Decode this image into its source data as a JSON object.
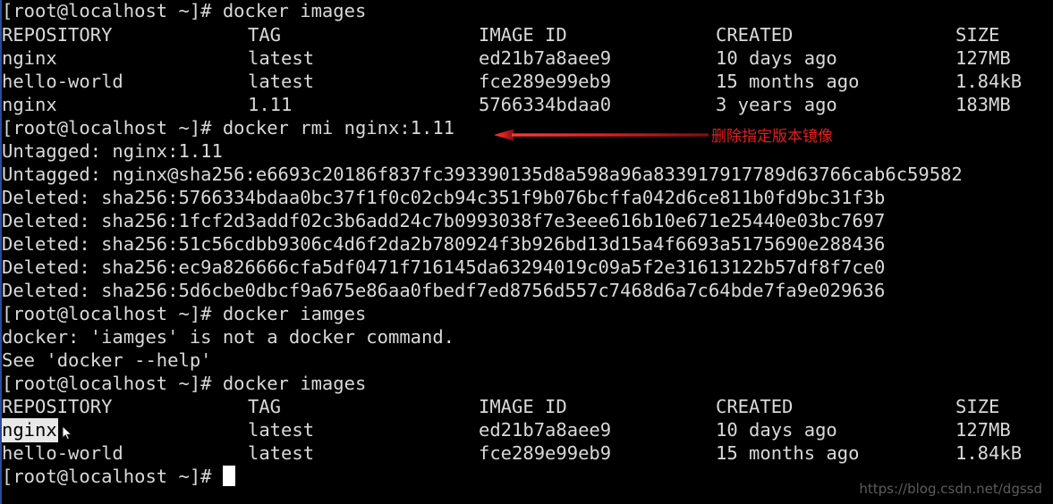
{
  "terminal": {
    "prompt": "[root@localhost ~]# ",
    "background_color": "#000000",
    "foreground_color": "#d9d9d9",
    "accent_stripe_color": "#2b4a9b",
    "selection_background": "#e8e8e8",
    "selection_foreground": "#000000"
  },
  "table_headers": {
    "repository": "REPOSITORY",
    "tag": "TAG",
    "image_id": "IMAGE ID",
    "created": "CREATED",
    "size": "SIZE"
  },
  "commands": {
    "images_1": "docker images",
    "rmi": "docker rmi nginx:1.11",
    "images_typo": "docker iamges",
    "images_2": "docker images"
  },
  "first_images_table": [
    {
      "repository": "nginx",
      "tag": "latest",
      "image_id": "ed21b7a8aee9",
      "created": "10 days ago",
      "size": "127MB"
    },
    {
      "repository": "hello-world",
      "tag": "latest",
      "image_id": "fce289e99eb9",
      "created": "15 months ago",
      "size": "1.84kB"
    },
    {
      "repository": "nginx",
      "tag": "1.11",
      "image_id": "5766334bdaa0",
      "created": "3 years ago",
      "size": "183MB"
    }
  ],
  "rmi_output": [
    "Untagged: nginx:1.11",
    "Untagged: nginx@sha256:e6693c20186f837fc393390135d8a598a96a833917917789d63766cab6c59582",
    "Deleted: sha256:5766334bdaa0bc37f1f0c02cb94c351f9b076bcffa042d6ce811b0fd9bc31f3b",
    "Deleted: sha256:1fcf2d3addf02c3b6add24c7b0993038f7e3eee616b10e671e25440e03bc7697",
    "Deleted: sha256:51c56cdbb9306c4d6f2da2b780924f3b926bd13d15a4f6693a5175690e288436",
    "Deleted: sha256:ec9a826666cfa5df0471f716145da63294019c09a5f2e31613122b57df8f7ce0",
    "Deleted: sha256:5d6cbe0dbcf9a675e86aa0fbedf7ed8756d557c7468d6a7c64bde7fa9e029636"
  ],
  "error_output": [
    "docker: 'iamges' is not a docker command.",
    "See 'docker --help'"
  ],
  "second_images_table": [
    {
      "repository": "nginx",
      "tag": "latest",
      "image_id": "ed21b7a8aee9",
      "created": "10 days ago",
      "size": "127MB",
      "selected": true
    },
    {
      "repository": "hello-world",
      "tag": "latest",
      "image_id": "fce289e99eb9",
      "created": "15 months ago",
      "size": "1.84kB",
      "selected": false
    }
  ],
  "annotation": {
    "text": "删除指定版本镜像",
    "color": "#e02020",
    "points_to": "docker rmi nginx:1.11"
  },
  "watermark": {
    "text": "https://blog.csdn.net/dgssd",
    "color": "#5c5c5c"
  }
}
